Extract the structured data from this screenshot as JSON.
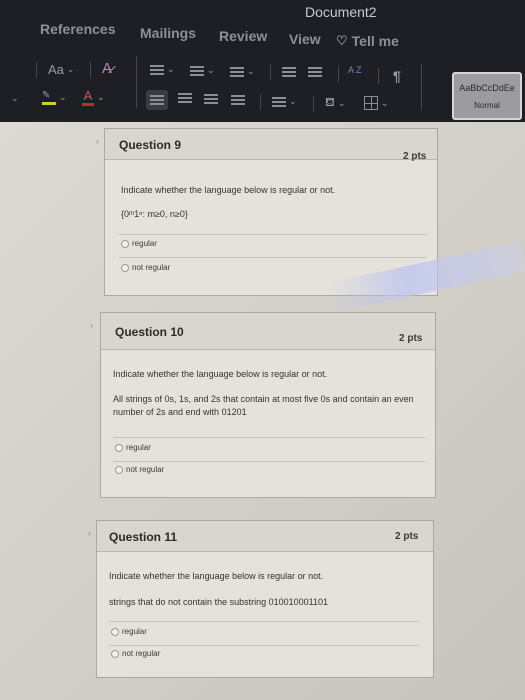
{
  "app": {
    "document_title": "Document2"
  },
  "ribbon": {
    "tabs": [
      {
        "label": "References"
      },
      {
        "label": "Mailings"
      },
      {
        "label": "Review"
      },
      {
        "label": "View"
      }
    ],
    "tell_me": "Tell me",
    "font_case_label": "Aa",
    "pilcrow": "¶",
    "sort_label": "A Z",
    "style_gallery": {
      "preview": "AaBbCcDdEe",
      "name": "Normal"
    }
  },
  "questions": [
    {
      "title": "Question 9",
      "points": "2 pts",
      "prompt": "Indicate whether the language below is regular or not.",
      "language": "{0ᵐ1ⁿ: m≥0, n≥0}",
      "options": [
        "regular",
        "not regular"
      ]
    },
    {
      "title": "Question 10",
      "points": "2 pts",
      "prompt": "Indicate whether the language below is regular or not.",
      "language": "All strings of 0s, 1s, and 2s that contain at most five 0s and contain an even number of 2s and end with 01201",
      "options": [
        "regular",
        "not regular"
      ]
    },
    {
      "title": "Question 11",
      "points": "2 pts",
      "prompt": "Indicate whether the language below is regular or not.",
      "language": "strings that do not contain the substring 010010001101",
      "options": [
        "regular",
        "not regular"
      ]
    }
  ],
  "collapse_glyph": "›"
}
